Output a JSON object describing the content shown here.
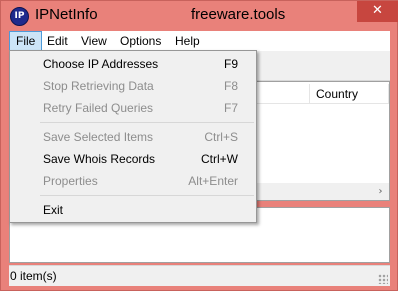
{
  "window": {
    "title": "IPNetInfo",
    "watermark": "freeware.tools",
    "icon_label": "IP",
    "close_glyph": "✕"
  },
  "menubar": {
    "items": [
      {
        "label": "File",
        "active": true
      },
      {
        "label": "Edit"
      },
      {
        "label": "View"
      },
      {
        "label": "Options"
      },
      {
        "label": "Help"
      }
    ]
  },
  "file_menu": {
    "items": [
      {
        "label": "Choose IP Addresses",
        "shortcut": "F9",
        "enabled": true
      },
      {
        "label": "Stop Retrieving Data",
        "shortcut": "F8",
        "enabled": false
      },
      {
        "label": "Retry Failed Queries",
        "shortcut": "F7",
        "enabled": false
      },
      {
        "label": "Save Selected Items",
        "shortcut": "Ctrl+S",
        "enabled": false
      },
      {
        "label": "Save Whois Records",
        "shortcut": "Ctrl+W",
        "enabled": true
      },
      {
        "label": "Properties",
        "shortcut": "Alt+Enter",
        "enabled": false
      },
      {
        "label": "Exit",
        "shortcut": "",
        "enabled": true
      }
    ]
  },
  "listview": {
    "columns": [
      {
        "label": "Country"
      }
    ],
    "scroll_right_glyph": "›"
  },
  "statusbar": {
    "text": "0 item(s)"
  },
  "colors": {
    "window_frame": "#e9817a",
    "close_button": "#c7463f",
    "menu_highlight": "#cce4f7",
    "disabled_text": "#8d8d8d"
  }
}
